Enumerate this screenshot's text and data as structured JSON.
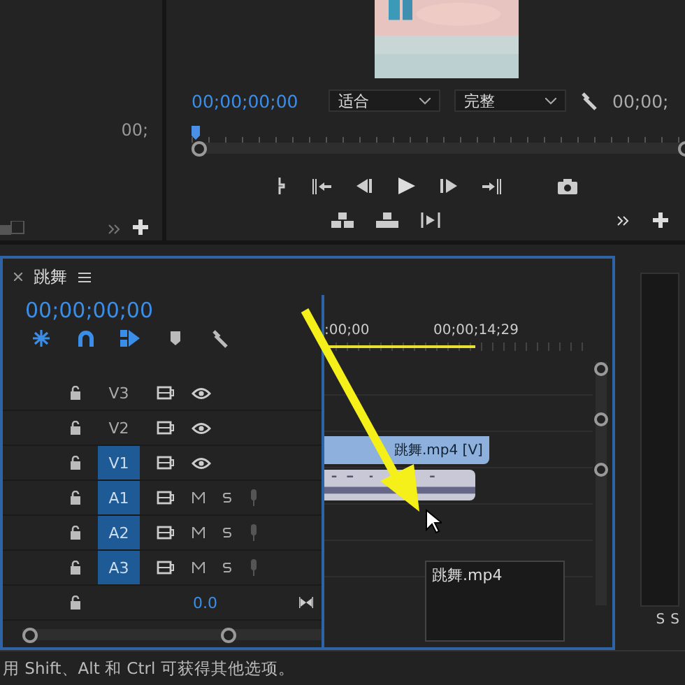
{
  "source_panel": {
    "timecode": "00;"
  },
  "program": {
    "timecode": "00;00;00;00",
    "zoom_select": "适合",
    "quality_select": "完整",
    "duration": "00;00;"
  },
  "timeline": {
    "tab": "跳舞",
    "timecode": "00;00;00;00",
    "tools": [
      {
        "kind": "nest",
        "on": true
      },
      {
        "kind": "snap",
        "on": true
      },
      {
        "kind": "linked",
        "on": true
      },
      {
        "kind": "marker",
        "on": false
      },
      {
        "kind": "settings",
        "on": false
      }
    ],
    "ruler": [
      ":00;00",
      "00;00;14;29"
    ],
    "tracks": [
      {
        "name": "V3",
        "kind": "video",
        "target": false
      },
      {
        "name": "V2",
        "kind": "video",
        "target": false
      },
      {
        "name": "V1",
        "kind": "video",
        "target": true,
        "clip": "跳舞.mp4 [V]"
      },
      {
        "name": "A1",
        "kind": "audio",
        "target": true,
        "audio_clip": true
      },
      {
        "name": "A2",
        "kind": "audio",
        "target": true
      },
      {
        "name": "A3",
        "kind": "audio",
        "target": true
      }
    ],
    "master": {
      "value": "0.0"
    },
    "tooltip": "跳舞.mp4"
  },
  "meters": [
    "S",
    "S"
  ],
  "status_bar": "用 Shift、Alt 和 Ctrl 可获得其他选项。"
}
